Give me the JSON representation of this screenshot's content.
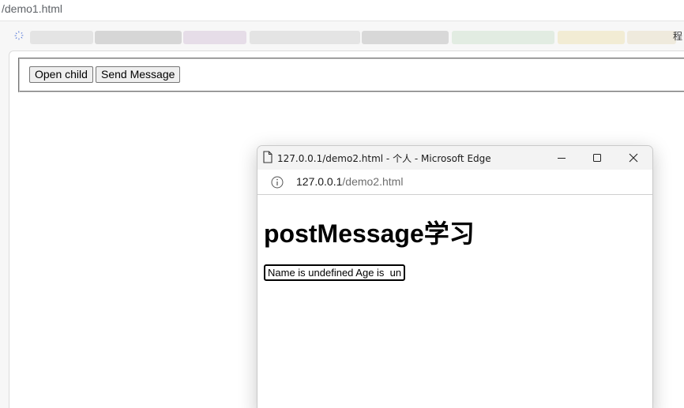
{
  "browser": {
    "url_text": "/demo1.html"
  },
  "bookmarks_bar": {
    "left_glyph": "҉",
    "right_glyph": "程"
  },
  "main_page": {
    "open_child_label": "Open child",
    "send_message_label": "Send Message"
  },
  "popup": {
    "title": "127.0.0.1/demo2.html - 个人 - Microsoft Edge",
    "address_host": "127.0.0.1",
    "address_path": "/demo2.html",
    "heading": "postMessage学习",
    "input_value": "Name is undefined Age is  undefined"
  },
  "icons": {
    "page": "document-icon",
    "minimize": "minimize-icon",
    "maximize": "maximize-icon",
    "close": "close-icon",
    "info": "info-icon"
  },
  "colors": {
    "page_bg": "#f7f7f7",
    "button_bg": "#efefef",
    "button_border": "#767676",
    "address_path": "#6e6e6e"
  }
}
